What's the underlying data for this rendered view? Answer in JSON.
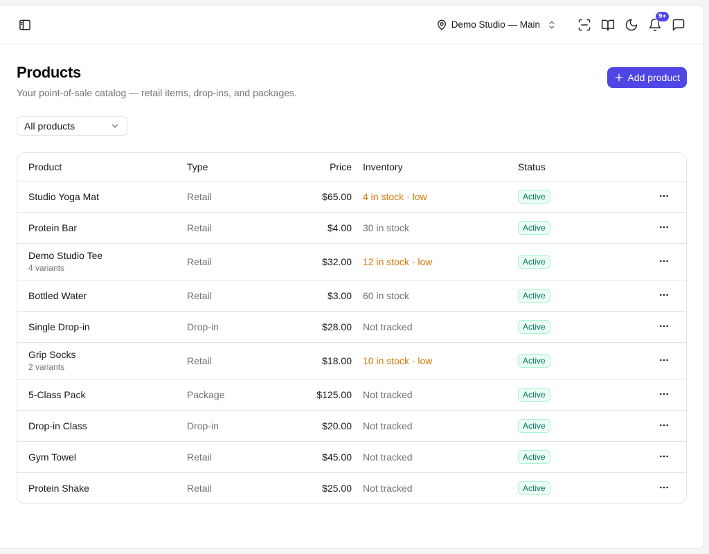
{
  "topbar": {
    "location": "Demo Studio — Main",
    "notifications_badge": "9+"
  },
  "page": {
    "title": "Products",
    "subtitle": "Your point-of-sale catalog — retail items, drop-ins, and packages.",
    "add_button": "Add product",
    "filter_value": "All products"
  },
  "table": {
    "headers": {
      "product": "Product",
      "type": "Type",
      "price": "Price",
      "inventory": "Inventory",
      "status": "Status"
    },
    "rows": [
      {
        "name": "Studio Yoga Mat",
        "variants": "",
        "type": "Retail",
        "price": "$65.00",
        "inventory": "4 in stock · low",
        "low": true,
        "status": "Active"
      },
      {
        "name": "Protein Bar",
        "variants": "",
        "type": "Retail",
        "price": "$4.00",
        "inventory": "30 in stock",
        "low": false,
        "status": "Active"
      },
      {
        "name": "Demo Studio Tee",
        "variants": "4 variants",
        "type": "Retail",
        "price": "$32.00",
        "inventory": "12 in stock · low",
        "low": true,
        "status": "Active"
      },
      {
        "name": "Bottled Water",
        "variants": "",
        "type": "Retail",
        "price": "$3.00",
        "inventory": "60 in stock",
        "low": false,
        "status": "Active"
      },
      {
        "name": "Single Drop-in",
        "variants": "",
        "type": "Drop-in",
        "price": "$28.00",
        "inventory": "Not tracked",
        "low": false,
        "status": "Active"
      },
      {
        "name": "Grip Socks",
        "variants": "2 variants",
        "type": "Retail",
        "price": "$18.00",
        "inventory": "10 in stock · low",
        "low": true,
        "status": "Active"
      },
      {
        "name": "5-Class Pack",
        "variants": "",
        "type": "Package",
        "price": "$125.00",
        "inventory": "Not tracked",
        "low": false,
        "status": "Active"
      },
      {
        "name": "Drop-in Class",
        "variants": "",
        "type": "Drop-in",
        "price": "$20.00",
        "inventory": "Not tracked",
        "low": false,
        "status": "Active"
      },
      {
        "name": "Gym Towel",
        "variants": "",
        "type": "Retail",
        "price": "$45.00",
        "inventory": "Not tracked",
        "low": false,
        "status": "Active"
      },
      {
        "name": "Protein Shake",
        "variants": "",
        "type": "Retail",
        "price": "$25.00",
        "inventory": "Not tracked",
        "low": false,
        "status": "Active"
      }
    ]
  },
  "colors": {
    "accent": "#4f46e5",
    "low_stock": "#d97706",
    "active_badge": "#047857"
  },
  "icons": [
    "sidebar-toggle-icon",
    "map-pin-icon",
    "chevron-up-down-icon",
    "scan-icon",
    "book-icon",
    "moon-icon",
    "bell-icon",
    "message-icon",
    "plus-icon",
    "chevron-down-icon",
    "more-horizontal-icon"
  ]
}
